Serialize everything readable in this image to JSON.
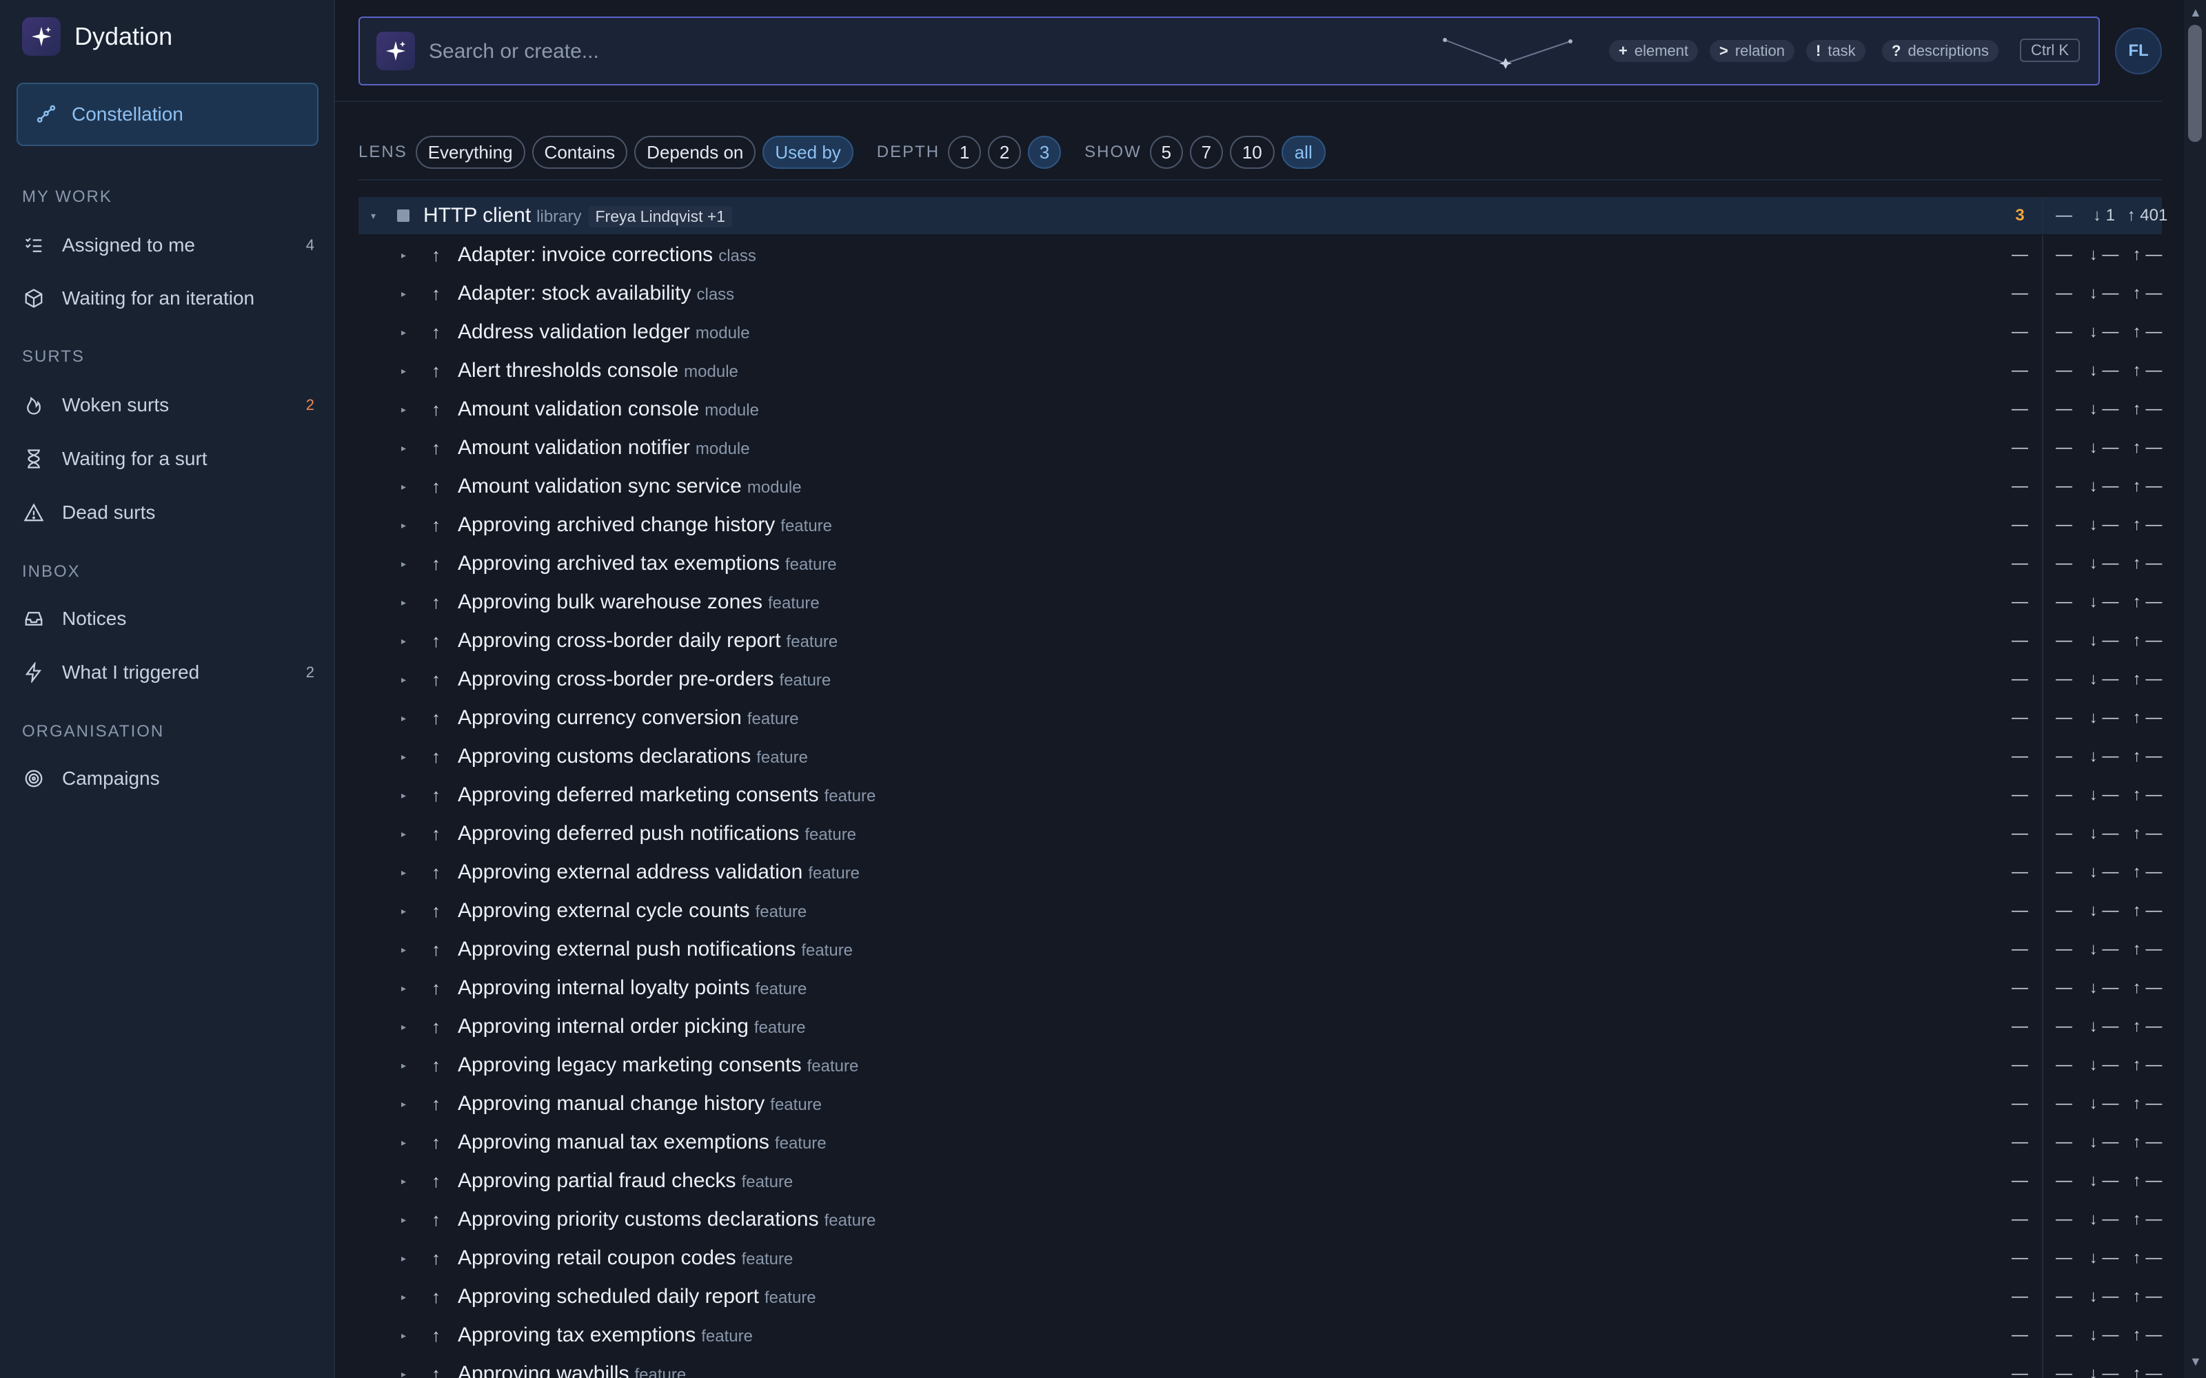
{
  "app": {
    "name": "Dydation"
  },
  "sidebar": {
    "active": {
      "label": "Constellation",
      "icon": "constellation-icon"
    },
    "sections": [
      {
        "title": "MY WORK",
        "items": [
          {
            "label": "Assigned to me",
            "icon": "checklist-icon",
            "count": "4",
            "warn": false
          },
          {
            "label": "Waiting for an iteration",
            "icon": "box-icon",
            "count": "",
            "warn": false
          }
        ]
      },
      {
        "title": "SURTS",
        "items": [
          {
            "label": "Woken surts",
            "icon": "flame-icon",
            "count": "2",
            "warn": true
          },
          {
            "label": "Waiting for a surt",
            "icon": "hourglass-icon",
            "count": "",
            "warn": false
          },
          {
            "label": "Dead surts",
            "icon": "warning-icon",
            "count": "",
            "warn": false
          }
        ]
      },
      {
        "title": "INBOX",
        "items": [
          {
            "label": "Notices",
            "icon": "inbox-icon",
            "count": "",
            "warn": false
          },
          {
            "label": "What I triggered",
            "icon": "bolt-icon",
            "count": "2",
            "warn": false
          }
        ]
      },
      {
        "title": "ORGANISATION",
        "items": [
          {
            "label": "Campaigns",
            "icon": "target-icon",
            "count": "",
            "warn": false
          }
        ]
      }
    ]
  },
  "search": {
    "placeholder": "Search or create...",
    "hints": [
      {
        "key": "+",
        "label": "element"
      },
      {
        "key": ">",
        "label": "relation"
      },
      {
        "key": "!",
        "label": "task"
      },
      {
        "key": "?",
        "label": "descriptions"
      }
    ],
    "shortcut": "Ctrl K"
  },
  "user": {
    "initials": "FL"
  },
  "lens": {
    "label": "LENS",
    "options": [
      "Everything",
      "Contains",
      "Depends on",
      "Used by"
    ],
    "active": "Used by",
    "depth_label": "DEPTH",
    "depths": [
      "1",
      "2",
      "3"
    ],
    "depth_active": "3",
    "show_label": "SHOW",
    "shows": [
      "5",
      "7",
      "10",
      "all"
    ],
    "show_active": "all"
  },
  "tree": {
    "root": {
      "name": "HTTP client",
      "type": "library",
      "owner": "Freya Lindqvist +1",
      "col_a": "3",
      "col_c": "—",
      "col_d": "↓ 1",
      "col_e": "↑ 401"
    },
    "dash": "—",
    "down_dash": "↓ —",
    "up_dash": "↑ —",
    "children": [
      {
        "name": "Adapter: invoice corrections",
        "type": "class"
      },
      {
        "name": "Adapter: stock availability",
        "type": "class"
      },
      {
        "name": "Address validation ledger",
        "type": "module"
      },
      {
        "name": "Alert thresholds console",
        "type": "module"
      },
      {
        "name": "Amount validation console",
        "type": "module"
      },
      {
        "name": "Amount validation notifier",
        "type": "module"
      },
      {
        "name": "Amount validation sync service",
        "type": "module"
      },
      {
        "name": "Approving archived change history",
        "type": "feature"
      },
      {
        "name": "Approving archived tax exemptions",
        "type": "feature"
      },
      {
        "name": "Approving bulk warehouse zones",
        "type": "feature"
      },
      {
        "name": "Approving cross-border daily report",
        "type": "feature"
      },
      {
        "name": "Approving cross-border pre-orders",
        "type": "feature"
      },
      {
        "name": "Approving currency conversion",
        "type": "feature"
      },
      {
        "name": "Approving customs declarations",
        "type": "feature"
      },
      {
        "name": "Approving deferred marketing consents",
        "type": "feature"
      },
      {
        "name": "Approving deferred push notifications",
        "type": "feature"
      },
      {
        "name": "Approving external address validation",
        "type": "feature"
      },
      {
        "name": "Approving external cycle counts",
        "type": "feature"
      },
      {
        "name": "Approving external push notifications",
        "type": "feature"
      },
      {
        "name": "Approving internal loyalty points",
        "type": "feature"
      },
      {
        "name": "Approving internal order picking",
        "type": "feature"
      },
      {
        "name": "Approving legacy marketing consents",
        "type": "feature"
      },
      {
        "name": "Approving manual change history",
        "type": "feature"
      },
      {
        "name": "Approving manual tax exemptions",
        "type": "feature"
      },
      {
        "name": "Approving partial fraud checks",
        "type": "feature"
      },
      {
        "name": "Approving priority customs declarations",
        "type": "feature"
      },
      {
        "name": "Approving retail coupon codes",
        "type": "feature"
      },
      {
        "name": "Approving scheduled daily report",
        "type": "feature"
      },
      {
        "name": "Approving tax exemptions",
        "type": "feature"
      },
      {
        "name": "Approving waybills",
        "type": "feature"
      }
    ]
  },
  "colors": {
    "accent": "#8ec1f2",
    "warn": "#f08a55",
    "count_highlight": "#f0a53a",
    "bg": "#141923",
    "sidebar": "#192231"
  }
}
